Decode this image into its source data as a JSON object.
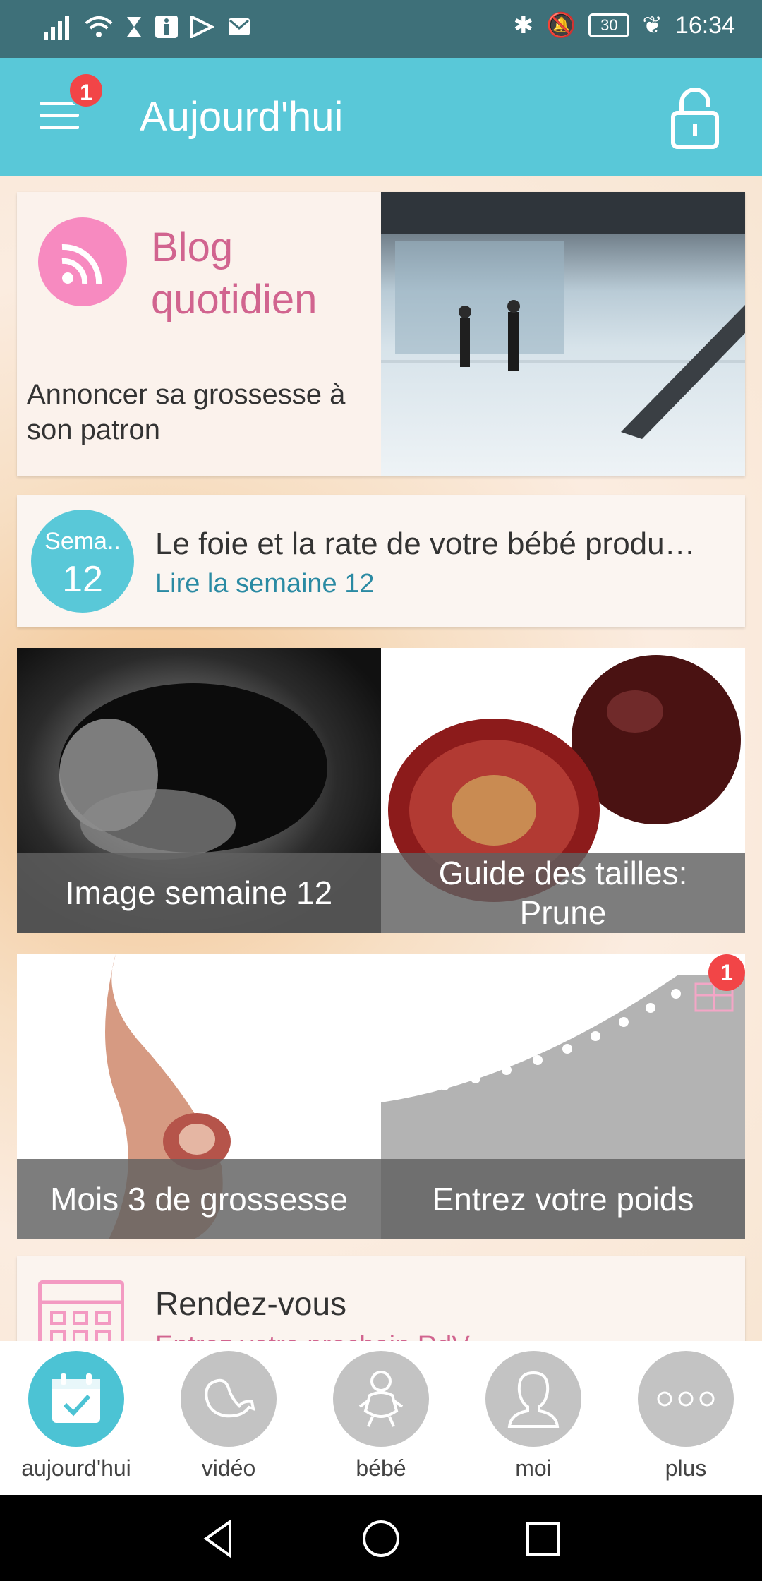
{
  "status_bar": {
    "time": "16:34",
    "battery": "30"
  },
  "app_bar": {
    "title": "Aujourd'hui",
    "menu_badge": "1"
  },
  "blog_card": {
    "title": "Blog quotidien",
    "text": "Annoncer sa grossesse à son patron"
  },
  "week_card": {
    "label": "Sema..",
    "number": "12",
    "headline": "Le foie et la rate de votre bébé produ…",
    "link": "Lire la semaine 12"
  },
  "tiles": [
    {
      "caption": "Image semaine 12"
    },
    {
      "caption": "Guide des tailles: Prune"
    },
    {
      "caption": "Mois 3 de grossesse"
    },
    {
      "caption": "Entrez votre poids",
      "badge": "1"
    }
  ],
  "rdv_card": {
    "title": "Rendez-vous",
    "subtitle": "Entrez votre prochain RdV"
  },
  "bottom_nav": [
    {
      "label": "aujourd'hui",
      "icon": "calendar-check-icon",
      "active": true
    },
    {
      "label": "vidéo",
      "icon": "fetus-icon"
    },
    {
      "label": "bébé",
      "icon": "baby-icon"
    },
    {
      "label": "moi",
      "icon": "person-icon"
    },
    {
      "label": "plus",
      "icon": "more-dots-icon"
    }
  ],
  "colors": {
    "accent": "#59c8d8",
    "status_bar": "#3e7079",
    "pink": "#d1648f",
    "badge": "#f24547"
  }
}
